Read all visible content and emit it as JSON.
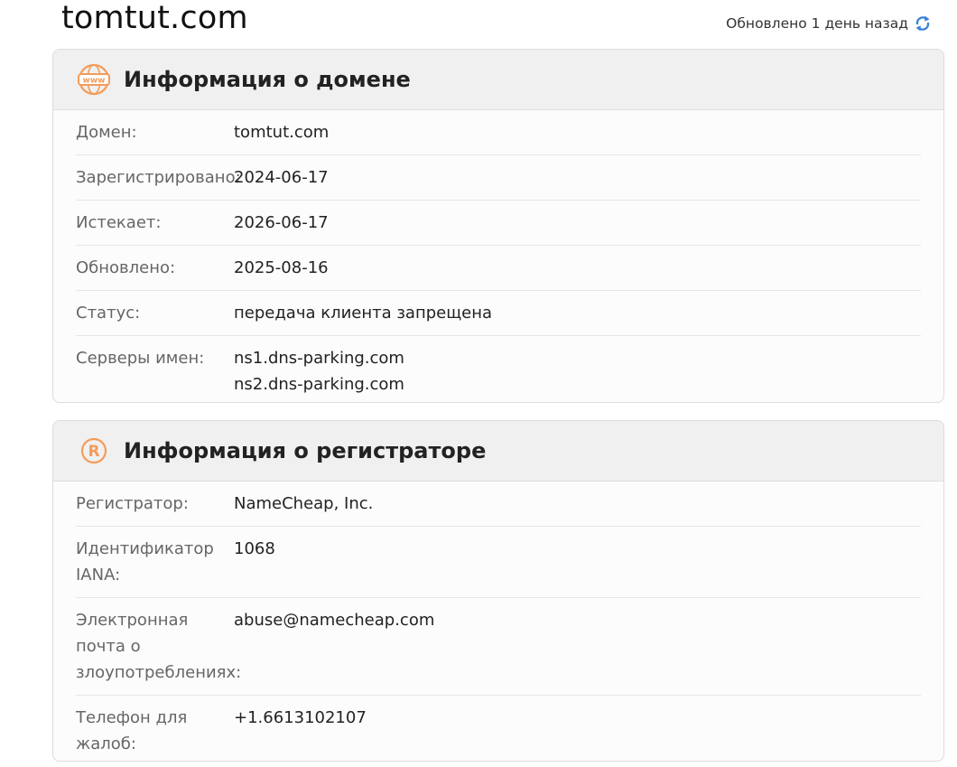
{
  "header": {
    "site_title": "tomtut.com",
    "updated_text": "Обновлено 1 день назад",
    "refresh_icon": "refresh-icon"
  },
  "domain_card": {
    "title": "Информация о домене",
    "icon": "www-globe-icon",
    "rows": [
      {
        "label": "Домен:",
        "value": "tomtut.com"
      },
      {
        "label": "Зарегистрировано:",
        "value": "2024-06-17"
      },
      {
        "label": "Истекает:",
        "value": "2026-06-17"
      },
      {
        "label": "Обновлено:",
        "value": "2025-08-16"
      },
      {
        "label": "Статус:",
        "value": "передача клиента запрещена"
      },
      {
        "label": "Серверы имен:",
        "values": [
          "ns1.dns-parking.com",
          "ns2.dns-parking.com"
        ]
      }
    ]
  },
  "registrar_card": {
    "title": "Информация о регистраторе",
    "icon": "registered-icon",
    "rows": [
      {
        "label": "Регистратор:",
        "value": "NameCheap, Inc."
      },
      {
        "label": "Идентификатор IANA:",
        "value": "1068"
      },
      {
        "label": "Электронная почта о злоупотреблениях:",
        "value": "abuse@namecheap.com"
      },
      {
        "label": "Телефон для жалоб:",
        "value": "+1.6613102107"
      }
    ]
  },
  "colors": {
    "accent_orange": "#f39c5a",
    "refresh_blue": "#3b82d6",
    "header_bg": "#f0f0f0",
    "label_gray": "#666666"
  }
}
